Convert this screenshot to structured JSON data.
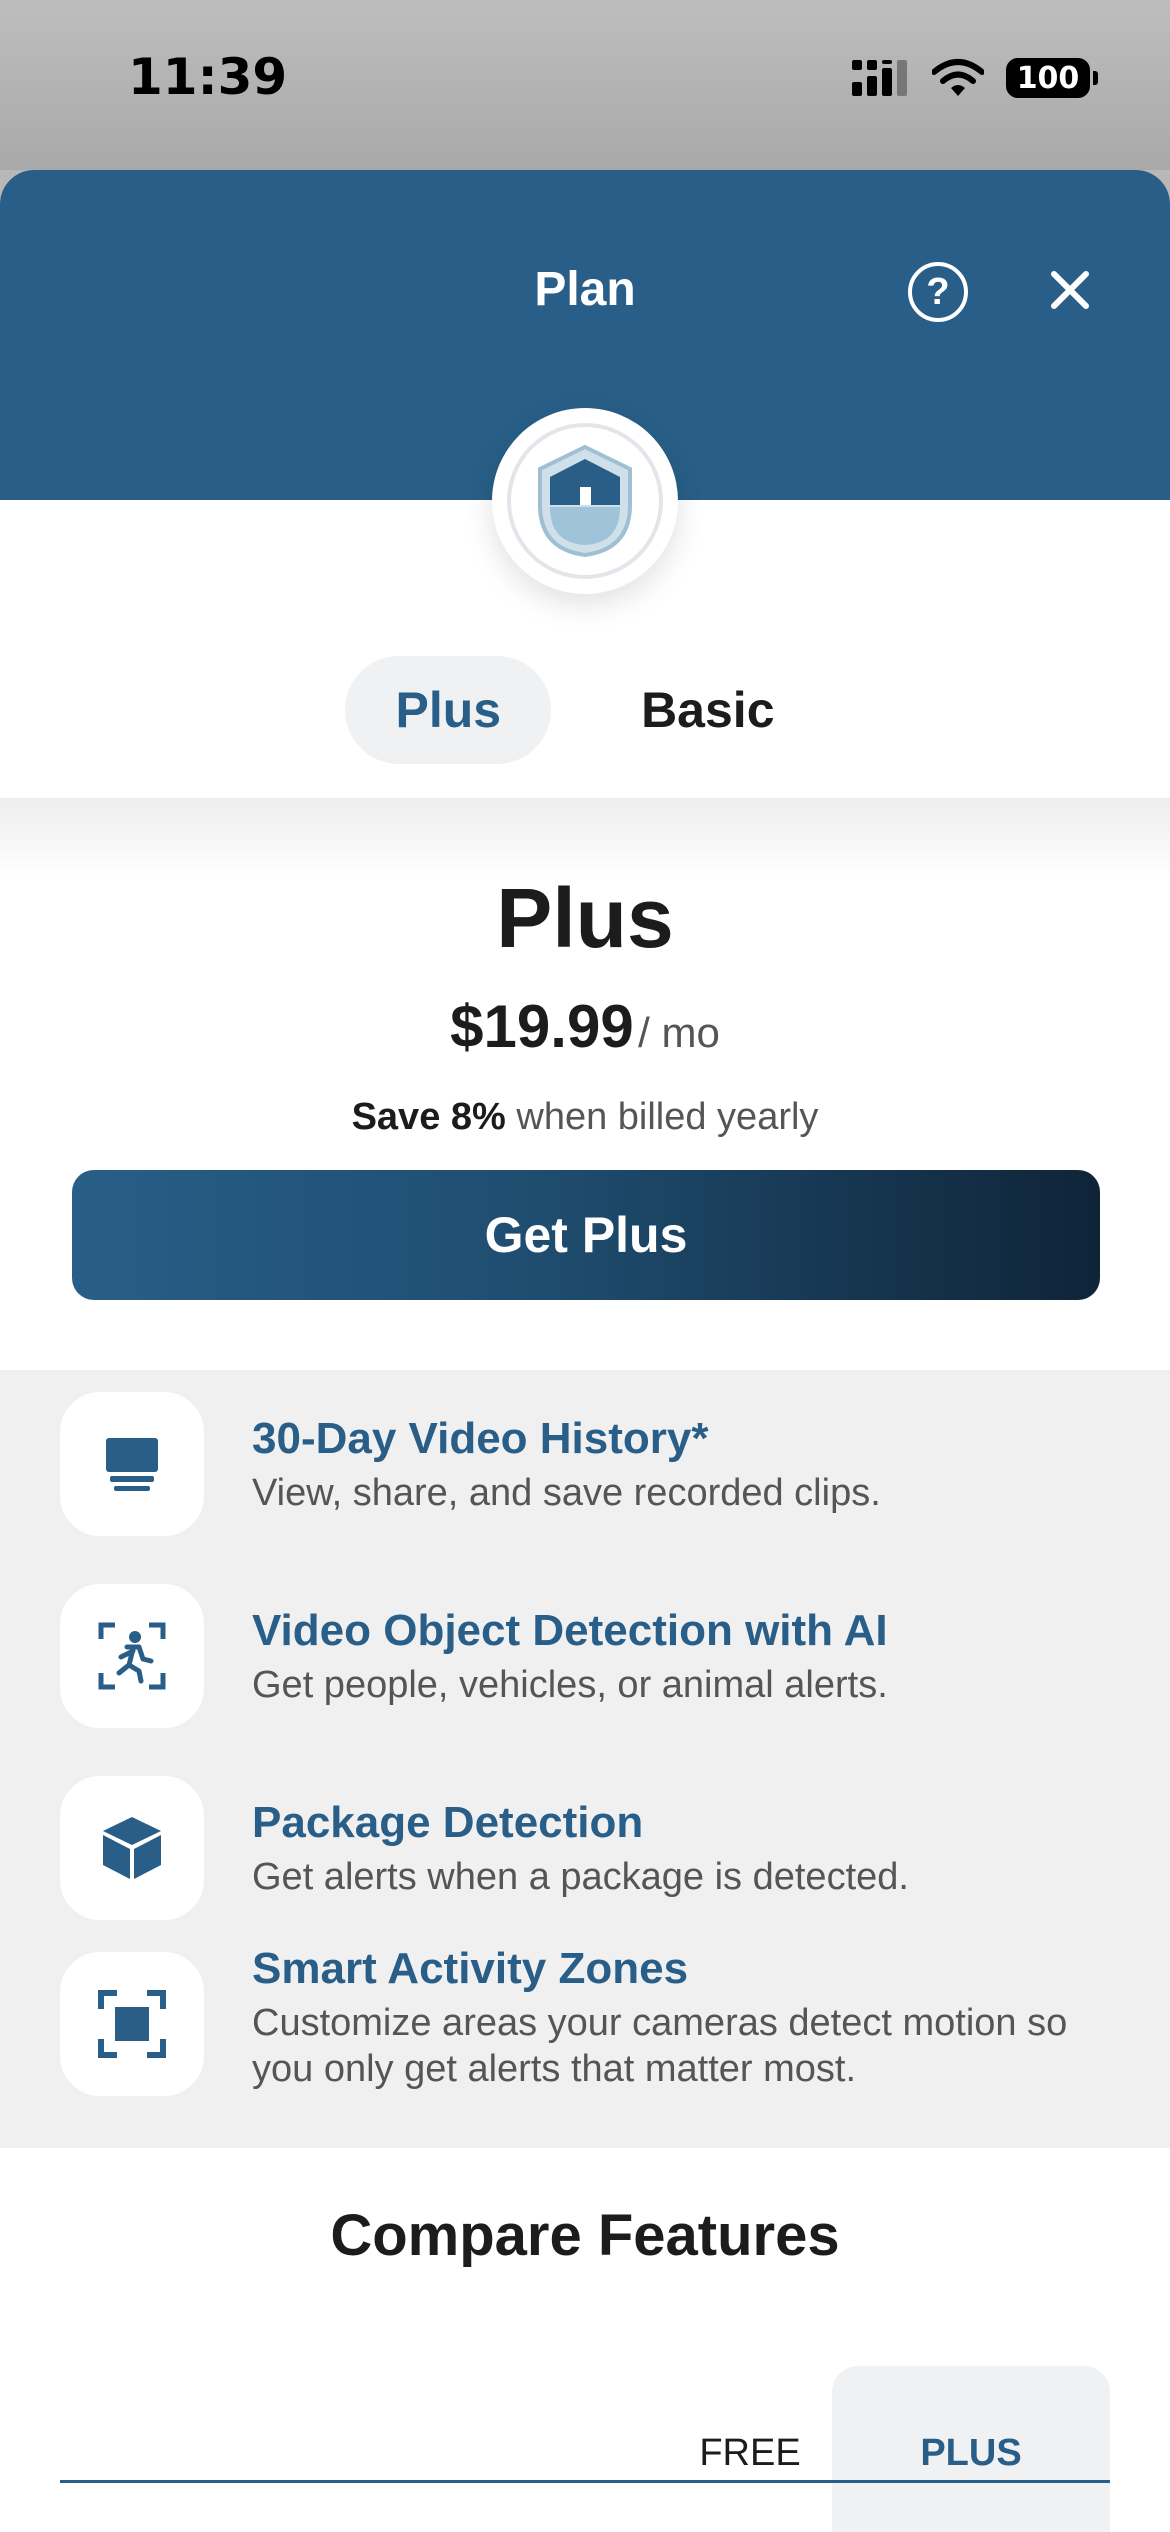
{
  "status_bar": {
    "time": "11:39",
    "battery": "100"
  },
  "header": {
    "title": "Plan",
    "help_icon": "question-circle-icon",
    "close_icon": "close-icon"
  },
  "logo": {
    "icon": "home-shield-icon"
  },
  "tabs": [
    {
      "label": "Plus",
      "active": true
    },
    {
      "label": "Basic",
      "active": false
    }
  ],
  "plan": {
    "name": "Plus",
    "price": "$19.99",
    "period": "/ mo",
    "save_bold": "Save 8%",
    "save_rest": " when billed yearly",
    "cta_label": "Get Plus"
  },
  "features": [
    {
      "icon": "video-history-icon",
      "title": "30-Day Video History*",
      "description": "View, share, and save recorded clips."
    },
    {
      "icon": "person-detection-icon",
      "title": "Video Object Detection with AI",
      "description": "Get people, vehicles, or animal alerts."
    },
    {
      "icon": "package-icon",
      "title": "Package Detection",
      "description": "Get alerts when a package is detected."
    },
    {
      "icon": "activity-zone-icon",
      "title": "Smart Activity Zones",
      "description": "Customize areas your cameras detect motion so you only get alerts that matter most."
    }
  ],
  "compare": {
    "title": "Compare Features",
    "col_free": "FREE",
    "col_plus": "PLUS"
  },
  "colors": {
    "brand_blue": "#285e87",
    "cta_dark": "#0f2438",
    "feature_bg": "#f0f0f1"
  }
}
